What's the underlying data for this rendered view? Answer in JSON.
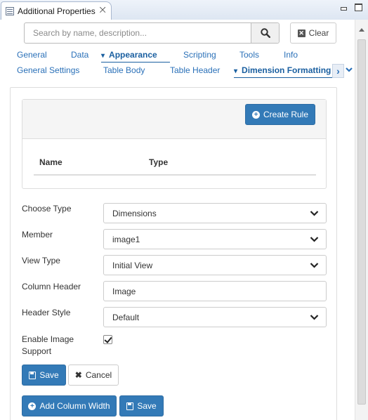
{
  "view": {
    "title": "Additional Properties",
    "close_icon": "close-icon",
    "minimize_icon": "minimize-icon",
    "maximize_icon": "maximize-icon"
  },
  "search": {
    "placeholder": "Search by name, description...",
    "value": "",
    "button_icon": "search-icon",
    "clear_label": "Clear"
  },
  "tabs": [
    {
      "label": "General",
      "active": false
    },
    {
      "label": "Data",
      "active": false
    },
    {
      "label": "Appearance",
      "active": true
    },
    {
      "label": "Scripting",
      "active": false
    },
    {
      "label": "Tools",
      "active": false
    },
    {
      "label": "Info",
      "active": false
    }
  ],
  "subtabs": [
    {
      "label": "General Settings",
      "active": false
    },
    {
      "label": "Table Body",
      "active": false
    },
    {
      "label": "Table Header",
      "active": false
    },
    {
      "label": "Dimension Formatting",
      "active": true
    }
  ],
  "rules": {
    "create_label": "Create Rule",
    "columns": [
      "Name",
      "Type"
    ],
    "rows": []
  },
  "form": {
    "choose_type": {
      "label": "Choose Type",
      "value": "Dimensions"
    },
    "member": {
      "label": "Member",
      "value": "image1"
    },
    "view_type": {
      "label": "View Type",
      "value": "Initial View"
    },
    "column_header": {
      "label": "Column Header",
      "value": "Image"
    },
    "header_style": {
      "label": "Header Style",
      "value": "Default"
    },
    "enable_image": {
      "label": "Enable Image Support",
      "checked": true
    }
  },
  "buttons": {
    "save": "Save",
    "cancel": "Cancel",
    "add_column_width": "Add Column Width",
    "save2": "Save"
  },
  "colors": {
    "primary": "#337ab7",
    "link": "#2a70b8"
  }
}
